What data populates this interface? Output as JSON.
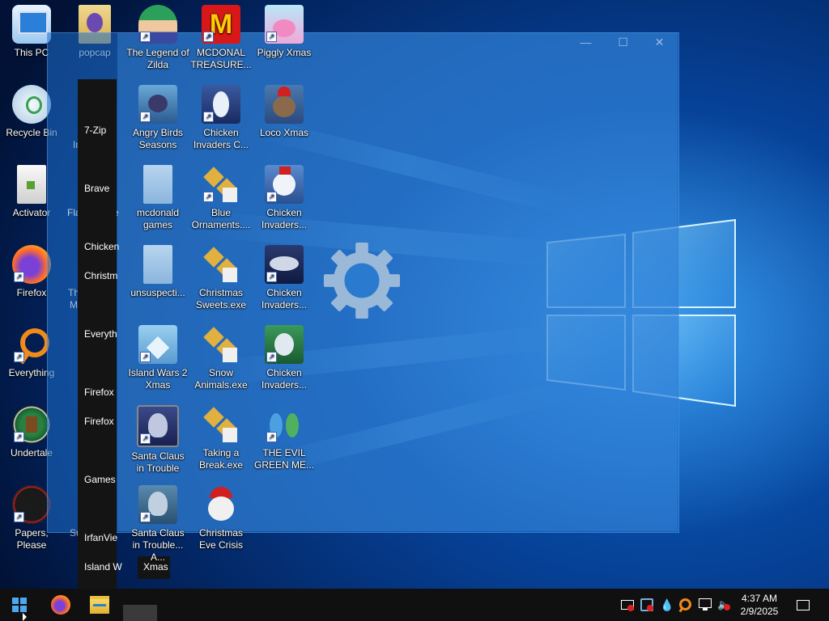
{
  "colors": {
    "taskbar": "#101010",
    "overlay": "#1e70cd",
    "start_menu": "#141414"
  },
  "desktop_icons": [
    {
      "label": "This PC",
      "icon": "this-pc-icon"
    },
    {
      "label": "Recycle Bin",
      "icon": "recycle-bin-icon"
    },
    {
      "label": "Activator",
      "icon": "file-icon"
    },
    {
      "label": "Firefox",
      "icon": "firefox-icon"
    },
    {
      "label": "Everything",
      "icon": "everything-search-icon"
    },
    {
      "label": "Undertale",
      "icon": "undertale-icon"
    },
    {
      "label": "Papers, Please",
      "icon": "papers-please-icon"
    },
    {
      "label": "popcap",
      "icon": "folder-icon"
    },
    {
      "label": "The Legend of Zilda",
      "icon": "game-icon"
    },
    {
      "label": "MCDONAL TREASURE...",
      "icon": "mcdonalds-icon"
    },
    {
      "label": "Piggly Xmas",
      "icon": "pig-icon"
    },
    {
      "label": "Angry Birds Seasons",
      "icon": "angry-birds-icon"
    },
    {
      "label": "Chicken Invaders C...",
      "icon": "chicken-invaders-icon"
    },
    {
      "label": "Loco Xmas",
      "icon": "loco-xmas-icon"
    },
    {
      "label": "mcdonald games",
      "icon": "folder-icon"
    },
    {
      "label": "Blue Ornaments....",
      "icon": "installer-icon"
    },
    {
      "label": "Chicken Invaders...",
      "icon": "chicken-invaders-icon"
    },
    {
      "label": "unsuspecti...",
      "icon": "folder-icon"
    },
    {
      "label": "Christmas Sweets.exe",
      "icon": "installer-icon"
    },
    {
      "label": "Chicken Invaders...",
      "icon": "chicken-invaders-icon"
    },
    {
      "label": "Island Wars 2 Xmas",
      "icon": "island-wars-icon"
    },
    {
      "label": "Snow Animals.exe",
      "icon": "installer-icon"
    },
    {
      "label": "Chicken Invaders...",
      "icon": "chicken-invaders-icon"
    },
    {
      "label": "Santa Claus in Trouble",
      "icon": "santa-icon"
    },
    {
      "label": "Taking a Break.exe",
      "icon": "installer-icon"
    },
    {
      "label": "THE EVIL GREEN ME...",
      "icon": "evil-green-icon"
    },
    {
      "label": "Santa Claus in Trouble... A...",
      "icon": "santa-icon"
    },
    {
      "label": "Christmas Eve Crisis",
      "icon": "santa-hat-icon"
    }
  ],
  "start_menu_items": [
    "7-Zip",
    "Brave",
    "Chicken",
    "Christm",
    "Everyth",
    "Firefox",
    "Firefox",
    "Games",
    "IrfanVie",
    "Island W"
  ],
  "start_menu_extra": "Xmas",
  "peek_labels": [
    "Fla",
    "e",
    "Th",
    "M",
    "Su",
    "In"
  ],
  "taskbar": {
    "start": "windows-start-icon",
    "apps": [
      "firefox-icon",
      "file-explorer-icon",
      "app-icon"
    ]
  },
  "tray_icons": [
    "network-disconnected-icon",
    "security-alert-icon",
    "dropbox-icon",
    "search-icon",
    "network-icon",
    "volume-muted-icon"
  ],
  "clock": {
    "time": "4:37 AM",
    "date": "2/9/2025"
  },
  "notification": "notification-icon"
}
